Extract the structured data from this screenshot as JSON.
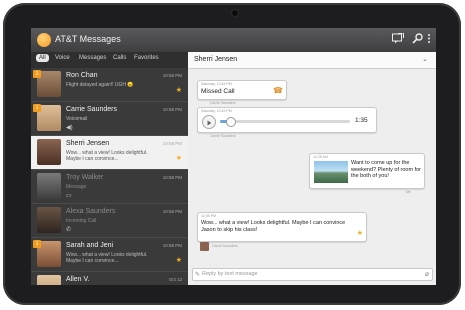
{
  "app": {
    "title": "AT&T Messages"
  },
  "toolbar": {
    "compose_icon": "compose-icon",
    "search_icon": "search-icon",
    "menu_icon": "overflow-icon"
  },
  "tabs": [
    {
      "label": "All",
      "active": true
    },
    {
      "label": "Voice"
    },
    {
      "label": "Messages"
    },
    {
      "label": "Calls"
    },
    {
      "label": "Favorites"
    }
  ],
  "conversations": [
    {
      "name": "Ron Chan",
      "preview": "Flight delayed again!! UGH 😠",
      "time": "10:58 PM",
      "badge": "1",
      "starred": true,
      "avatar": "#8a6b52"
    },
    {
      "name": "Carrie Saunders",
      "preview": "Voicemail",
      "time": "10:58 PM",
      "badge": "1",
      "starred": false,
      "avatar": "#c9a27a"
    },
    {
      "name": "Sherri Jensen",
      "preview": "Wow... what a view! Looks delightful. Maybe I can convince...",
      "time": "10:58 PM",
      "badge": "",
      "starred": true,
      "avatar": "#6b4a3a",
      "selected": true
    },
    {
      "name": "Troy Walker",
      "preview": "Message",
      "time": "10:58 PM",
      "badge": "",
      "starred": false,
      "avatar": "#5a5a5a",
      "dim": true
    },
    {
      "name": "Alexa Saunders",
      "preview": "Incoming Call",
      "time": "10:58 PM",
      "badge": "",
      "starred": false,
      "avatar": "#4a3a30",
      "dim": true
    },
    {
      "name": "Sarah and Jeni",
      "preview": "Wow... what a view! Looks delightful. Maybe I can convince...",
      "time": "10:58 PM",
      "badge": "1",
      "starred": true,
      "avatar": "#9b6b4b"
    },
    {
      "name": "Allen V.",
      "preview": "",
      "time": "Oct 12",
      "badge": "",
      "starred": false,
      "avatar": "#c4a484"
    }
  ],
  "thread": {
    "contact": "Sherri Jensen",
    "missed_call": {
      "meta": "Saturday, 12:49 PM",
      "label": "Missed Call",
      "sender": "Carrie Saunders"
    },
    "voicemail": {
      "meta": "Saturday, 12:49 PM",
      "duration": "1:35",
      "progress": 0.08,
      "sender": "Carrie Saunders"
    },
    "outgoing": {
      "meta": "12:25 AM",
      "text": "Want to come up for the weekend? Plenty of room for the both of you!",
      "sender": "Me"
    },
    "incoming": {
      "meta": "12:35 PM",
      "text": "Wow... what a view! Looks delightful. Maybe I can convince Jason to skip his class!",
      "sender": "Carrie Saunders"
    },
    "reply_placeholder": "Reply by text message"
  }
}
